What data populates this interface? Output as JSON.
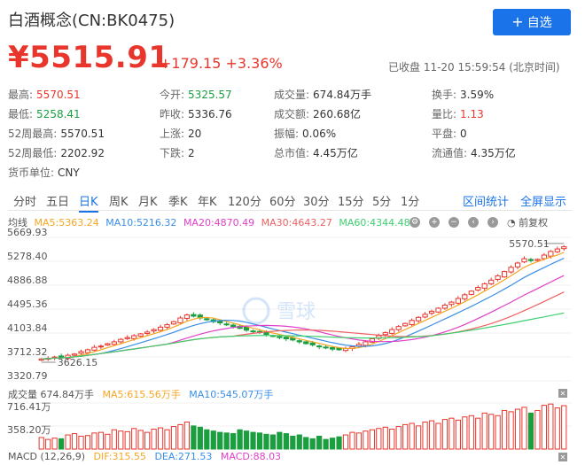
{
  "header": {
    "title": "白酒概念(CN:BK0475)",
    "add_button_label": "自选",
    "add_button_icon": "plus-icon",
    "price": "¥5515.91",
    "change_abs": "+179.15",
    "change_pct": "+3.36%",
    "status": "已收盘 11-20 15:59:54 (北京时间)"
  },
  "stats": {
    "high": {
      "label": "最高:",
      "value": "5570.51"
    },
    "low": {
      "label": "最低:",
      "value": "5258.41"
    },
    "high52": {
      "label": "52周最高:",
      "value": "5570.51"
    },
    "low52": {
      "label": "52周最低:",
      "value": "2202.92"
    },
    "currency": {
      "label": "货币单位:",
      "value": "CNY"
    },
    "open": {
      "label": "今开:",
      "value": "5325.57"
    },
    "prev_close": {
      "label": "昨收:",
      "value": "5336.76"
    },
    "rise": {
      "label": "上涨:",
      "value": "20"
    },
    "fall": {
      "label": "下跌:",
      "value": "2"
    },
    "volume": {
      "label": "成交量:",
      "value": "674.84万手"
    },
    "amount": {
      "label": "成交额:",
      "value": "260.68亿"
    },
    "amplitude": {
      "label": "振幅:",
      "value": "0.06%"
    },
    "total_cap": {
      "label": "总市值:",
      "value": "4.45万亿"
    },
    "turnover": {
      "label": "换手:",
      "value": "3.59%"
    },
    "vol_ratio": {
      "label": "量比:",
      "value": "1.13"
    },
    "flat": {
      "label": "平盘:",
      "value": "0"
    },
    "float_cap": {
      "label": "流通值:",
      "value": "4.35万亿"
    }
  },
  "tabs": [
    "分时",
    "五日",
    "日K",
    "周K",
    "月K",
    "季K",
    "年K",
    "120分",
    "60分",
    "30分",
    "15分",
    "5分",
    "1分"
  ],
  "active_tab": "日K",
  "links": {
    "interval_stats": "区间统计",
    "fullscreen": "全屏显示"
  },
  "chart_legend": {
    "label": "均线",
    "ma5": "MA5:5363.24",
    "ma10": "MA10:5216.32",
    "ma20": "MA20:4870.49",
    "ma30": "MA30:4643.27",
    "ma60": "MA60:4344.48",
    "adjust": "前复权"
  },
  "colors": {
    "up": "#e8362d",
    "down": "#1a9e3f",
    "ma5": "#f5a623",
    "ma10": "#3a8ee6",
    "ma20": "#e040c8",
    "ma30": "#f06060",
    "ma60": "#3ecf70"
  },
  "volume_legend": {
    "label": "成交量 674.84万手",
    "ma5": "MA5:615.56万手",
    "ma10": "MA10:545.07万手"
  },
  "macd_legend": {
    "label": "MACD (12,26,9)",
    "dif": "DIF:315.55",
    "dea": "DEA:271.53",
    "macd": "MACD:88.03"
  },
  "watermark": "雪球",
  "chart_data": {
    "type": "candlestick",
    "y_ticks": [
      "5669.93",
      "5278.40",
      "4886.88",
      "4495.36",
      "4103.84",
      "3712.32",
      "3320.79"
    ],
    "ylim": [
      3320.79,
      5669.93
    ],
    "annotations": {
      "max_label": "5570.51",
      "min_label": "3626.15"
    },
    "volume_ticks": [
      "716.41万",
      "358.20万"
    ],
    "volume_ylim": [
      0,
      716.41
    ],
    "closes": [
      3680,
      3690,
      3710,
      3700,
      3740,
      3760,
      3800,
      3830,
      3870,
      3890,
      3930,
      3960,
      4000,
      4030,
      4060,
      4090,
      4120,
      4160,
      4200,
      4240,
      4290,
      4350,
      4400,
      4380,
      4350,
      4320,
      4290,
      4270,
      4240,
      4210,
      4180,
      4150,
      4130,
      4110,
      4080,
      4050,
      4030,
      4010,
      3990,
      3960,
      3930,
      3910,
      3880,
      3860,
      3840,
      3830,
      3850,
      3880,
      3920,
      3960,
      4010,
      4060,
      4110,
      4160,
      4210,
      4260,
      4310,
      4360,
      4410,
      4460,
      4510,
      4560,
      4610,
      4670,
      4730,
      4790,
      4850,
      4910,
      4970,
      5040,
      5110,
      5180,
      5250,
      5320,
      5290,
      5310,
      5380,
      5440,
      5480,
      5515.91
    ],
    "volumes": [
      180,
      150,
      170,
      160,
      220,
      240,
      200,
      210,
      250,
      260,
      230,
      300,
      280,
      270,
      320,
      290,
      260,
      310,
      330,
      300,
      350,
      380,
      420,
      360,
      340,
      300,
      280,
      260,
      250,
      240,
      300,
      280,
      260,
      250,
      230,
      220,
      260,
      240,
      200,
      220,
      180,
      160,
      200,
      150,
      170,
      190,
      220,
      260,
      250,
      280,
      300,
      320,
      340,
      310,
      350,
      380,
      400,
      360,
      420,
      440,
      400,
      460,
      480,
      450,
      500,
      520,
      480,
      560,
      540,
      520,
      600,
      580,
      620,
      650,
      560,
      600,
      680,
      700,
      640,
      674.84
    ]
  }
}
